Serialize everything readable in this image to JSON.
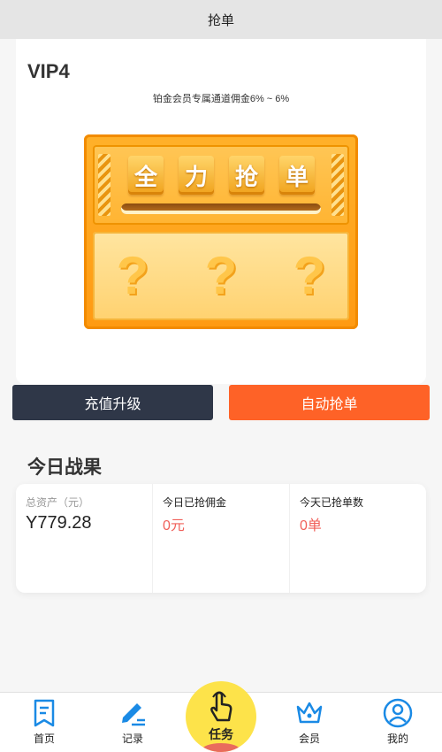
{
  "header": {
    "title": "抢单"
  },
  "vip": {
    "level": "VIP4",
    "description": "铂金会员专属通道佣金6% ~ 6%",
    "machine_chars": [
      "全",
      "力",
      "抢",
      "单"
    ],
    "machine_marks": [
      "?",
      "?",
      "?"
    ]
  },
  "actions": {
    "recharge_label": "充值升级",
    "auto_label": "自动抢单"
  },
  "results": {
    "title": "今日战果",
    "total_assets_label": "总资产（元）",
    "total_assets_value": "Y779.28",
    "today_commission_label": "今日已抢佣金",
    "today_commission_value": "0元",
    "today_orders_label": "今天已抢单数",
    "today_orders_value": "0单"
  },
  "tabs": {
    "home": "首页",
    "records": "记录",
    "task": "任务",
    "member": "会员",
    "mine": "我的"
  },
  "colors": {
    "recharge_button": "#2f3748",
    "auto_button": "#fe6227",
    "tab_icon": "#1a8ae5",
    "task_circle": "#fde34a",
    "value_red": "#f0605a"
  }
}
